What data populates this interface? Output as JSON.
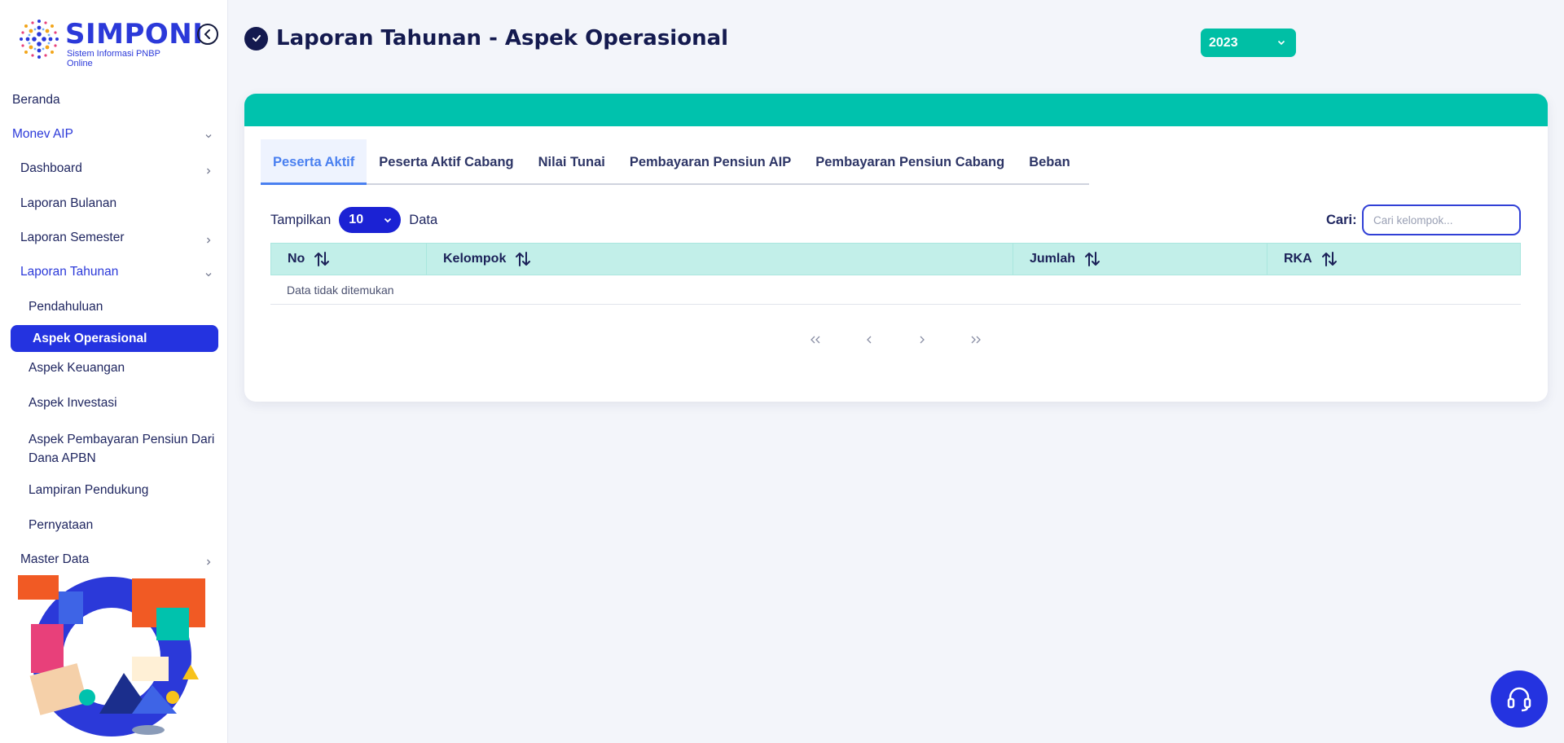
{
  "brand": {
    "title": "SIMPONI",
    "subtitle": "Sistem Informasi PNBP Online"
  },
  "sidebar": {
    "items": [
      {
        "label": "Beranda"
      },
      {
        "label": "Monev AIP"
      },
      {
        "label": "Dashboard"
      },
      {
        "label": "Laporan Bulanan"
      },
      {
        "label": "Laporan Semester"
      },
      {
        "label": "Laporan Tahunan"
      },
      {
        "label": "Pendahuluan"
      },
      {
        "label": "Aspek Operasional"
      },
      {
        "label": "Aspek Keuangan"
      },
      {
        "label": "Aspek Investasi"
      },
      {
        "label": "Aspek Pembayaran Pensiun Dari Dana APBN"
      },
      {
        "label": "Lampiran Pendukung"
      },
      {
        "label": "Pernyataan"
      },
      {
        "label": "Master Data"
      }
    ]
  },
  "header": {
    "title": "Laporan Tahunan - Aspek Operasional",
    "year": "2023"
  },
  "tabs": [
    {
      "label": "Peserta Aktif"
    },
    {
      "label": "Peserta Aktif Cabang"
    },
    {
      "label": "Nilai Tunai"
    },
    {
      "label": "Pembayaran Pensiun AIP"
    },
    {
      "label": "Pembayaran Pensiun Cabang"
    },
    {
      "label": "Beban"
    }
  ],
  "table_controls": {
    "show_label": "Tampilkan",
    "page_size": "10",
    "data_label": "Data",
    "search_label": "Cari:",
    "search_placeholder": "Cari kelompok..."
  },
  "table": {
    "columns": [
      "No",
      "Kelompok",
      "Jumlah",
      "RKA"
    ],
    "empty_text": "Data tidak ditemukan"
  },
  "colors": {
    "primary": "#2433e0",
    "teal": "#00c2ad",
    "navy": "#141a4f",
    "tab_active": "#4a80f0",
    "table_header": "#c2efe9"
  },
  "icons": {
    "collapse": "chevron-left-circle-icon",
    "title": "check-circle-icon",
    "sort": "sort-arrows-icon",
    "help": "headset-icon"
  }
}
